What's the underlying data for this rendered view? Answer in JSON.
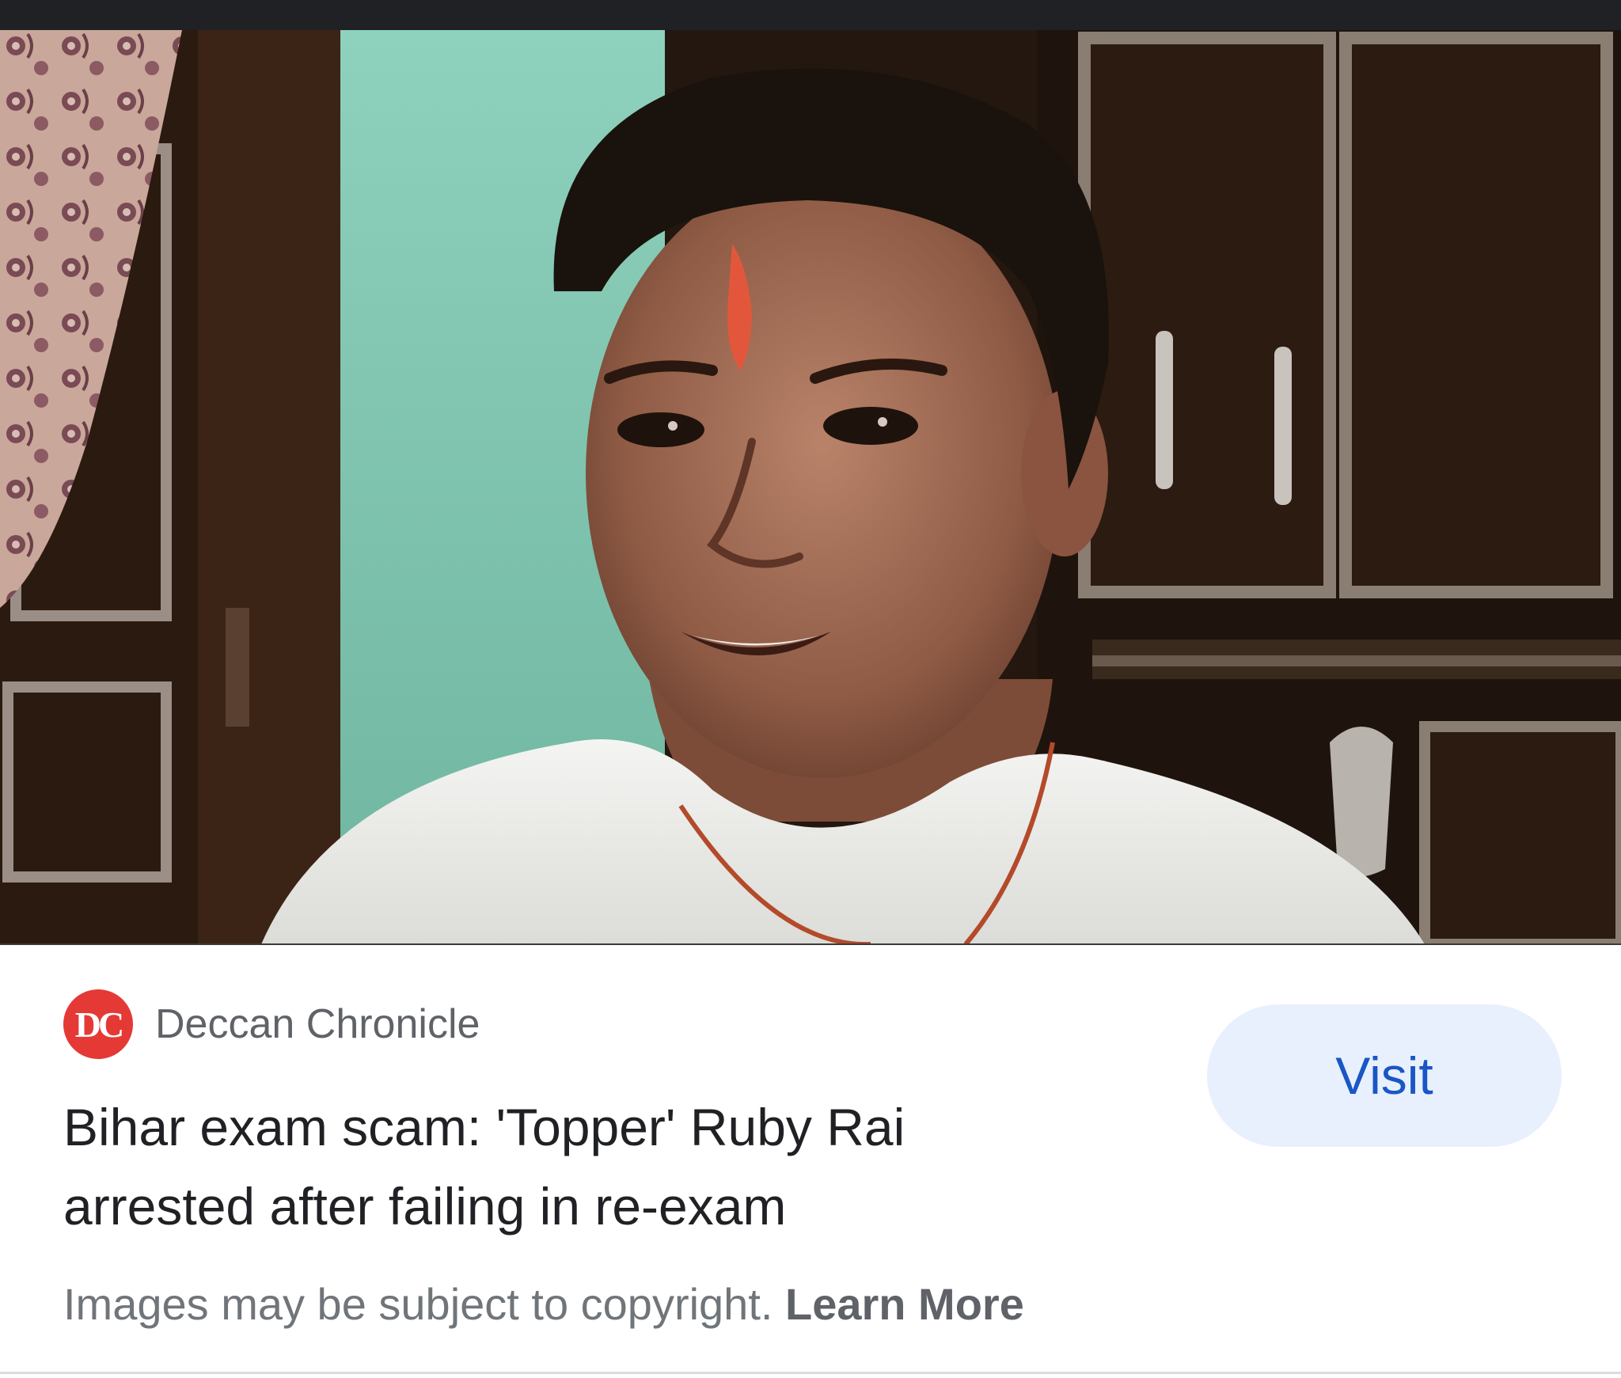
{
  "result_card": {
    "source": {
      "logo_text": "DC",
      "name": "Deccan Chronicle"
    },
    "headline_line1": "Bihar exam scam: 'Topper' Ruby Rai",
    "headline_line2": "arrested after failing in re-exam",
    "visit_label": "Visit",
    "copyright_notice": "Images may be subject to copyright.",
    "learn_more_label": "Learn More"
  },
  "colors": {
    "logo_red": "#e53935",
    "visit_bg": "#e8f0fe",
    "visit_text": "#1a56c4",
    "headline": "#202124",
    "muted": "#70757a"
  }
}
